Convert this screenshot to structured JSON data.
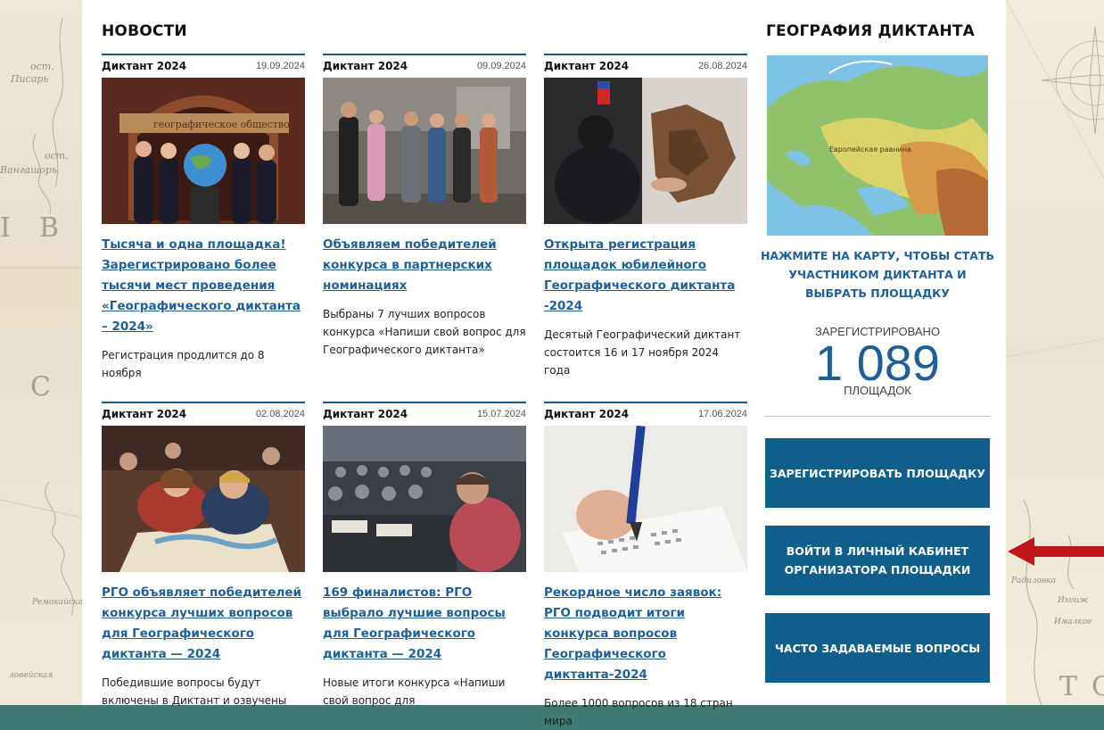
{
  "news": {
    "title": "НОВОСТИ",
    "items": [
      {
        "category": "Диктант 2024",
        "date": "19.09.2024",
        "title": "Тысяча и одна площадка! Зарегистрировано более тысячи мест проведения «Географического диктанта – 2024»",
        "text": "Регистрация продлится до 8 ноября",
        "image_text": "географическое общество"
      },
      {
        "category": "Диктант 2024",
        "date": "09.09.2024",
        "title": "Объявляем победителей конкурса в партнерских номинациях",
        "text": "Выбраны 7 лучших вопросов конкурса «Напиши свой вопрос для Географического диктанта»"
      },
      {
        "category": "Диктант 2024",
        "date": "26.08.2024",
        "title": "Открыта регистрация площадок юбилейного Географического диктанта -2024",
        "text": "Десятый Географический диктант состоится 16 и 17 ноября 2024 года"
      },
      {
        "category": "Диктант 2024",
        "date": "02.08.2024",
        "title": "РГО объявляет победителей конкурса лучших вопросов для Географического диктанта — 2024",
        "text": "Победившие вопросы будут включены в Диктант и озвучены"
      },
      {
        "category": "Диктант 2024",
        "date": "15.07.2024",
        "title": "169 финалистов: РГО выбрало лучшие вопросы для Географического диктанта — 2024",
        "text": "Новые итоги конкурса «Напиши свой вопрос для"
      },
      {
        "category": "Диктант 2024",
        "date": "17.06.2024",
        "title": "Рекордное число заявок: РГО подводит итоги конкурса вопросов Географического диктанта-2024",
        "text": "Более 1000 вопросов из 18 стран мира"
      }
    ]
  },
  "sidebar": {
    "title": "ГЕОГРАФИЯ ДИКТАНТА",
    "map_labels": [
      "Европейская равнина"
    ],
    "cta": "НАЖМИТЕ НА КАРТУ, ЧТОБЫ СТАТЬ УЧАСТНИКОМ ДИКТАНТА И ВЫБРАТЬ ПЛОЩАДКУ",
    "registered_label": "ЗАРЕГИСТРИРОВАНО",
    "registered_count": "1 089",
    "registered_unit": "ПЛОЩАДОК",
    "buttons": [
      "ЗАРЕГИСТРИРОВАТЬ ПЛОЩАДКУ",
      "ВОЙТИ В ЛИЧНЫЙ КАБИНЕТ ОРГАНИЗАТОРА ПЛОЩАДКИ",
      "ЧАСТО ЗАДАВАЕМЫЕ ВОПРОСЫ"
    ]
  },
  "background": {
    "left_labels": [
      "осm.",
      "Писарь",
      "осm.",
      "Вангашорь",
      "Ремокайская",
      "ловейская"
    ],
    "left_letters": [
      "I",
      "В",
      "С"
    ],
    "right_labels": [
      "Радиловка",
      "Ихоиж",
      "Ималкое"
    ],
    "right_letters": [
      "Т",
      "С"
    ]
  },
  "colors": {
    "accent": "#1e5f97",
    "button": "#0f5e8c",
    "arrow": "#c0151b",
    "frame": "#3f7a73"
  }
}
